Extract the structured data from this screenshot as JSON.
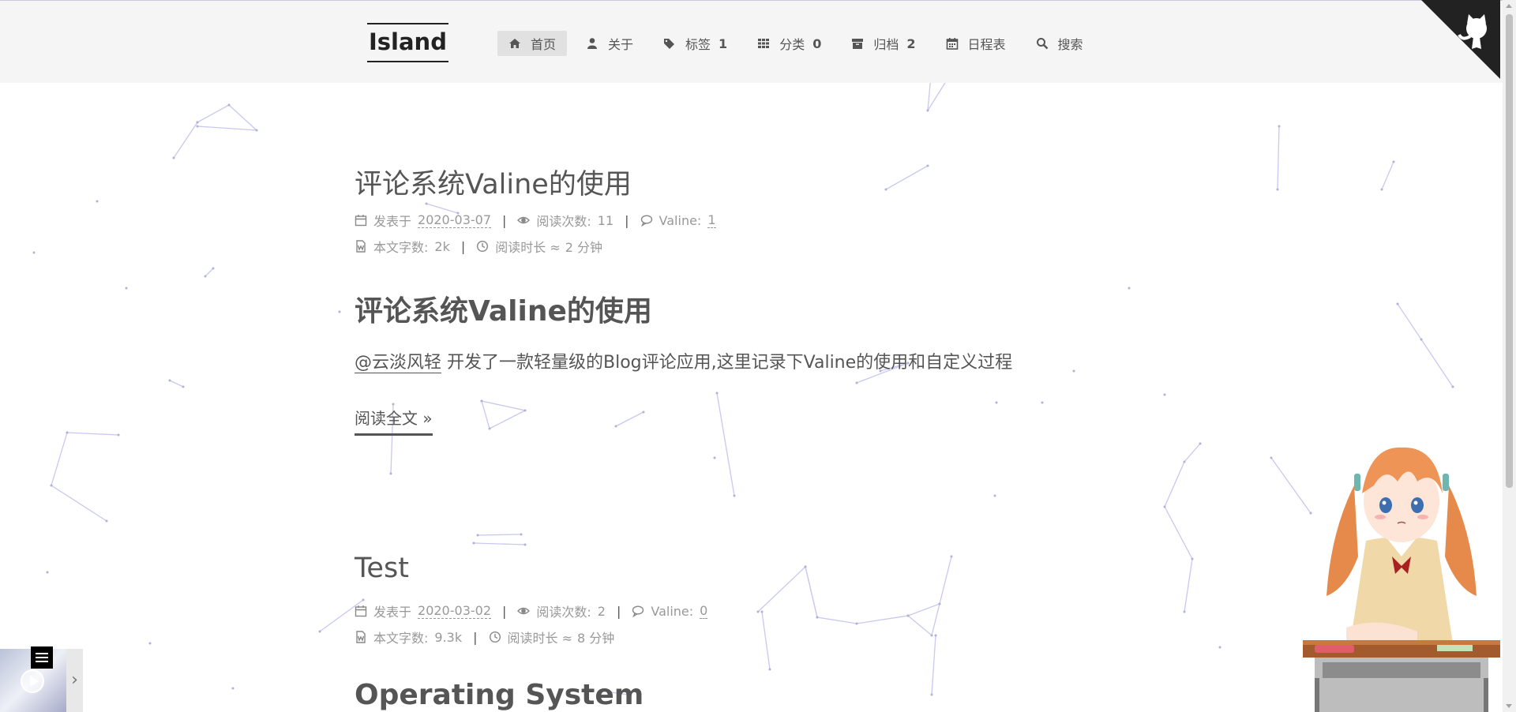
{
  "header": {
    "logo": "Island",
    "nav": [
      {
        "label": "首页",
        "icon": "home-icon",
        "count": null,
        "active": true
      },
      {
        "label": "关于",
        "icon": "user-icon",
        "count": null,
        "active": false
      },
      {
        "label": "标签",
        "icon": "tags-icon",
        "count": "1",
        "active": false
      },
      {
        "label": "分类",
        "icon": "th-icon",
        "count": "0",
        "active": false
      },
      {
        "label": "归档",
        "icon": "archive-icon",
        "count": "2",
        "active": false
      },
      {
        "label": "日程表",
        "icon": "calendar-icon",
        "count": null,
        "active": false
      },
      {
        "label": "搜索",
        "icon": "search-icon",
        "count": null,
        "active": false
      }
    ]
  },
  "posts": [
    {
      "title": "评论系统Valine的使用",
      "posted_label": "发表于",
      "date": "2020-03-07",
      "views_label": "阅读次数:",
      "views": "11",
      "comments_label": "Valine:",
      "comments": "1",
      "words_label": "本文字数:",
      "words": "2k",
      "readtime_label": "阅读时长 ≈",
      "readtime": "2 分钟",
      "heading": "评论系统Valine的使用",
      "excerpt_mention": "@云淡风轻",
      "excerpt_text": " 开发了一款轻量级的Blog评论应用,这里记录下Valine的使用和自定义过程",
      "read_more": "阅读全文 »"
    },
    {
      "title": "Test",
      "posted_label": "发表于",
      "date": "2020-03-02",
      "views_label": "阅读次数:",
      "views": "2",
      "comments_label": "Valine:",
      "comments": "0",
      "words_label": "本文字数:",
      "words": "9.3k",
      "readtime_label": "阅读时长 ≈",
      "readtime": "8 分钟",
      "heading": "Operating System"
    }
  ],
  "corner_icon": "github-cat-icon",
  "colors": {
    "header_bg": "#f5f5f5",
    "text": "#555555",
    "meta": "#999999",
    "network_lines": "#c8c8f0"
  }
}
